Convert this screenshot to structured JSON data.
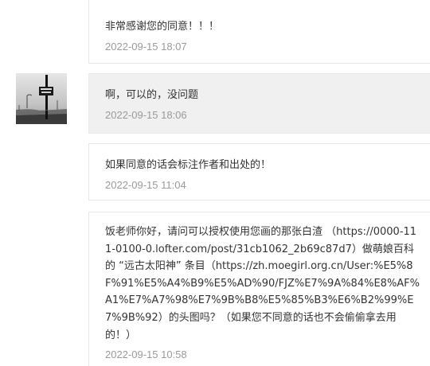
{
  "thread": {
    "messages": [
      {
        "text": "非常感谢您的同意！！！",
        "time": "2022-09-15 18:07"
      },
      {
        "text": "啊，可以的，没问题",
        "time": "2022-09-15 18:06"
      },
      {
        "text": "如果同意的话会标注作者和出处的！",
        "time": "2022-09-15 11:04"
      },
      {
        "text": "饭老师你好，请问可以授权使用您画的那张白渣 （https://0000-111-0100-0.lofter.com/post/31cb1062_2b69c87d7）做萌娘百科的 “远古太阳神” 条目（https://zh.moegirl.org.cn/User:%E5%8F%91%E5%A4%B9%E5%AD%90/FJZ%E7%9A%84%E8%AF%A1%E7%A7%98%E7%9B%B8%E5%85%B3%E6%B2%99%E7%9B%92）的头图吗？（如果您不同意的话也不会偷偷拿去用的！）",
        "time": "2022-09-15 10:58"
      }
    ]
  },
  "avatar": {
    "icon": "road-sign-photo-avatar"
  },
  "colors": {
    "sent_bg": "#ffffff",
    "received_bg": "#f0f0f0",
    "border": "#e7e7e7",
    "text": "#333333",
    "time": "#9a9a9a"
  }
}
